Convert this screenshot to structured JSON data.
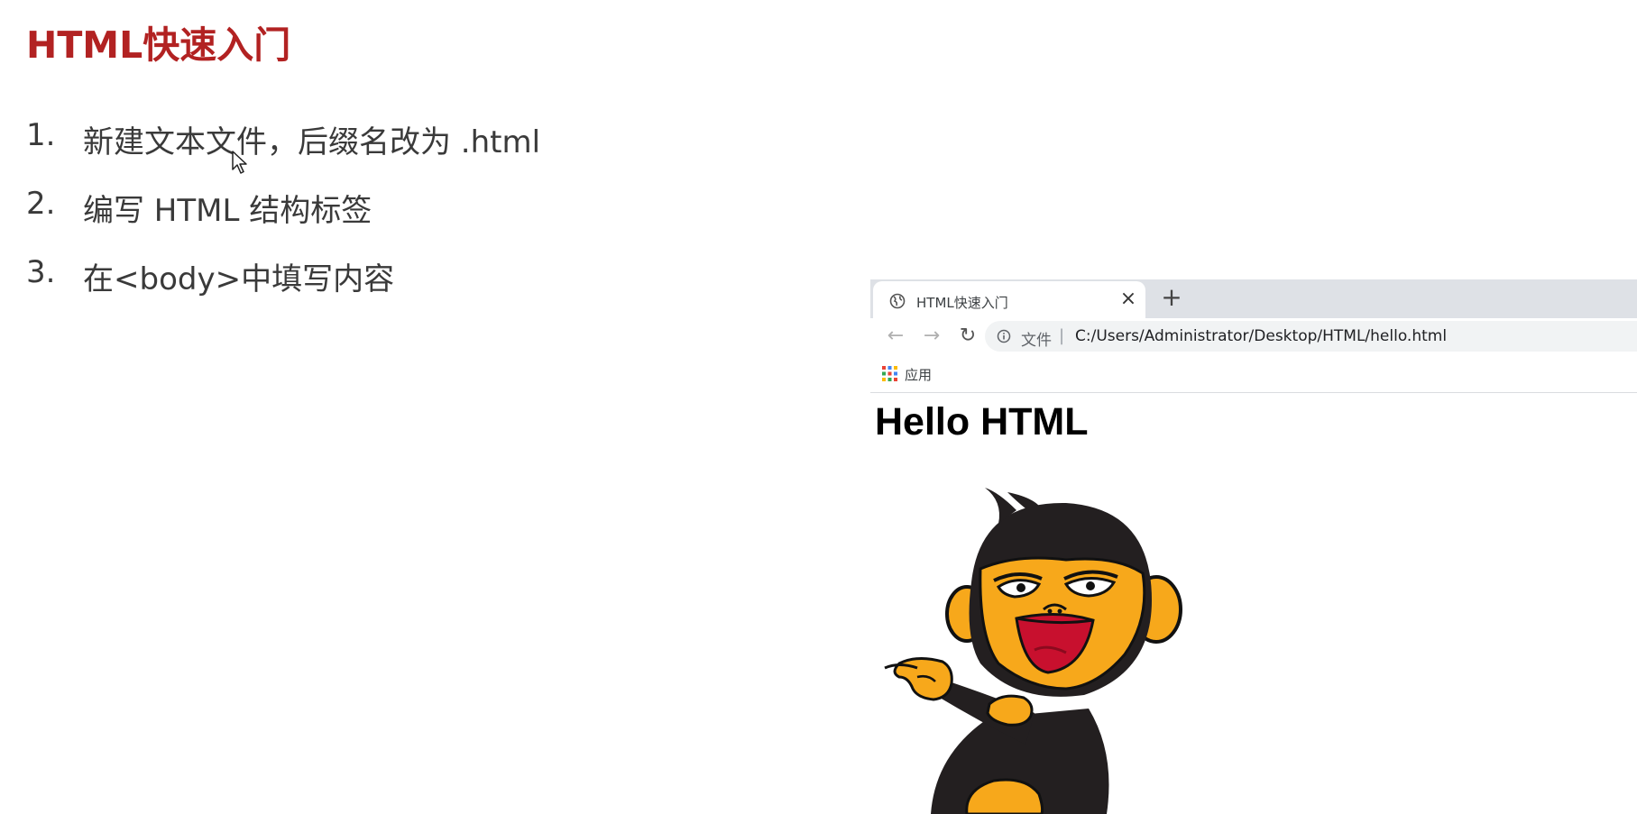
{
  "slide": {
    "title": "HTML快速入门",
    "steps": [
      {
        "num": "1.",
        "text": "新建文本文件，后缀名改为 .html"
      },
      {
        "num": "2.",
        "text": "编写 HTML 结构标签"
      },
      {
        "num": "3.",
        "text": "在<body>中填写内容"
      }
    ]
  },
  "browser": {
    "tab_title": "HTML快速入门",
    "tab_close": "×",
    "new_tab": "+",
    "nav_back": "←",
    "nav_forward": "→",
    "reload": "↻",
    "url_scheme_label": "文件",
    "url_divider": "|",
    "url": "C:/Users/Administrator/Desktop/HTML/hello.html",
    "bookmarks_apps_label": "应用",
    "page_heading": "Hello HTML"
  },
  "icons": {
    "cursor": "mouse-cursor-icon",
    "tab_favicon": "globe-icon",
    "close": "close-icon",
    "new_tab": "plus-icon",
    "back": "arrow-left-icon",
    "forward": "arrow-right-icon",
    "reload": "reload-icon",
    "site_info": "info-icon",
    "apps": "apps-grid-icon"
  },
  "colors": {
    "title": "#b22222",
    "tabstrip": "#dee1e6",
    "omnibox": "#f1f3f4",
    "monkey_body": "#231f20",
    "monkey_face": "#f7a81b",
    "monkey_mouth": "#c8102e"
  }
}
